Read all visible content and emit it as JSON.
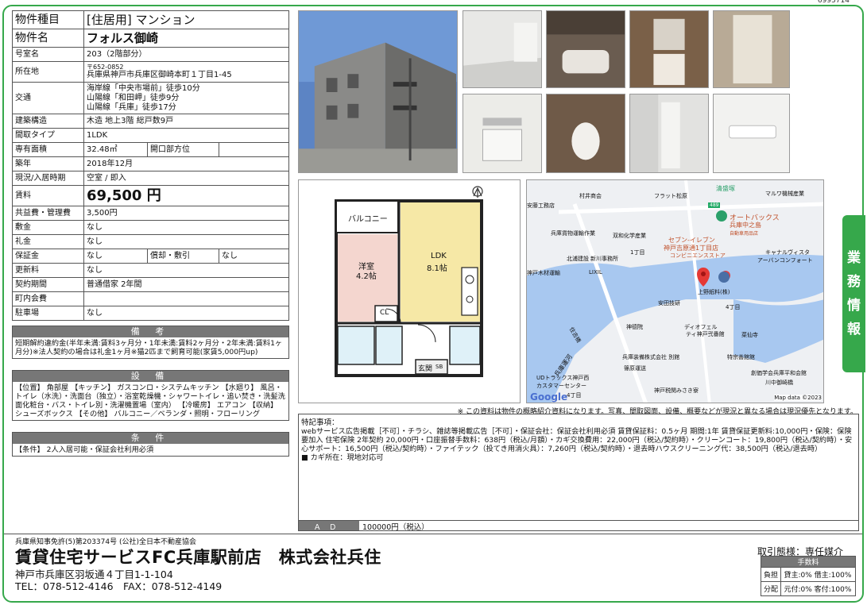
{
  "doc_id": "6995714",
  "spec": {
    "type_k": "物件種目",
    "type_v": "[住居用] マンション",
    "name_k": "物件名",
    "name_v": "フォルス御崎",
    "room_k": "号室名",
    "room_v": "203（2階部分）",
    "addr_k": "所在地",
    "zip": "〒652-0852",
    "addr_v": "兵庫県神戸市兵庫区御崎本町１丁目1-45",
    "access_k": "交通",
    "access_1": "海岸線「中央市場前」徒歩10分",
    "access_2": "山陽線「和田岬」徒歩9分",
    "access_3": "山陽線「兵庫」徒歩17分",
    "struct_k": "建築構造",
    "struct_v": "木造 地上3階 総戸数9戸",
    "layout_k": "間取タイプ",
    "layout_v": "1LDK",
    "area_k": "専有面積",
    "area_v": "32.48㎡",
    "dir_k": "開口部方位",
    "dir_v": "",
    "built_k": "築年",
    "built_v": "2018年12月",
    "status_k": "現況/入居時期",
    "status_v": "空室 / 即入",
    "rent_k": "賃料",
    "rent_v": "69,500 円",
    "mgmt_k": "共益費・管理費",
    "mgmt_v": "3,500円",
    "deposit_k": "敷金",
    "deposit_v": "なし",
    "key_k": "礼金",
    "key_v": "なし",
    "guar_k": "保証金",
    "guar_v": "なし",
    "amort_k": "償却・敷引",
    "amort_v": "なし",
    "renew_k": "更新料",
    "renew_v": "なし",
    "term_k": "契約期間",
    "term_v": "普通借家 2年間",
    "town_k": "町内会費",
    "town_v": "",
    "park_k": "駐車場",
    "park_v": "なし"
  },
  "notes": {
    "head": "備 考",
    "body": "短期解約違約金(半年未満:賃料3ヶ月分・1年未満:賃料2ヶ月分・2年未満:賃料1ヶ月分)※法人契約の場合は礼金1ヶ月※猫2匹まで飼育可能(家賃5,000円up)"
  },
  "equip": {
    "head": "設 備",
    "body": "【位置】 角部屋 【キッチン】 ガスコンロ・システムキッチン 【水廻り】 風呂・トイレ（水洗）・洗面台（独立）・浴室乾燥機・シャワートイレ・追い焚き・洗髪洗面化粧台・バス・トイレ別・洗濯機置場（室内） 【冷暖房】 エアコン 【収納】 シューズボックス 【その他】 バルコニー／ベランダ・照明・フローリング"
  },
  "cond": {
    "head": "条 件",
    "body": "【条件】 2人入居可能・保証会社利用必須"
  },
  "floorplan": {
    "balcony": "バルコニー",
    "western": "洋室",
    "western_size": "4.2帖",
    "ldk": "LDK",
    "ldk_size": "8.1帖",
    "cl": "CL",
    "entrance": "玄関",
    "sb": "SB"
  },
  "map": {
    "labels": [
      "清盛塚",
      "村井商会",
      "フラット松原",
      "マルワ機械産業",
      "安藤工務店",
      "兵庫貨物運輸作業",
      "双和化学産業",
      "オートバックス",
      "兵庫中之島",
      "自動車用品店",
      "セブン-イレブン",
      "神戸吉原通1丁目店",
      "コンビニエンスストア",
      "1丁目",
      "キャナルヴィスタ",
      "アーバンコンフォート",
      "北浦建設",
      "新川事務所",
      "LIXIL",
      "神戸木材運輸",
      "上野紙料(株)",
      "安田技研",
      "4丁目",
      "住吉橋",
      "兵庫運河",
      "神德院",
      "ディオフェル",
      "ティ神戸弐番館",
      "菜仙寺",
      "兵庫装備株式会社 別館",
      "篠原運送",
      "特宗善館館",
      "創価学会兵庫平和会館",
      "川中御崎橋",
      "UDトラックス神戸西",
      "カスタマーセンター",
      "神戸税関みさき寮",
      "4丁目",
      "489"
    ],
    "google": "Google",
    "credit": "Map data ©2023"
  },
  "disclaimer": "※ この資料は物件の概略紹介資料になります。写真、間取図面、設備、概要などが現況と異なる場合は現況優先となります。",
  "remarks": {
    "head": "特記事項：",
    "body": "webサービス広告掲載［不可］・チラシ、雑誌等掲載広告［不可］・保証会社：保証会社利用必須 賃貸保証料：0.5ヶ月 期間:1年 賃貸保証更新料:10,000円・保険：保険要加入 住宅保険 2年契約 20,000円・口座振替手数料：638円（税込/月額）・カギ交換費用：22,000円（税込/契約時）・クリーンコート：19,800円（税込/契約時）・安心サポート：16,500円（税込/契約時）・ファイテック（投てき用消火具）：7,260円（税込/契約時）・退去時ハウスクリーニング代：38,500円（税込/退去時）",
    "key": "■ カギ所在：現地対応可"
  },
  "ad": {
    "label": "ＡＤ",
    "value": "100000円（税込）"
  },
  "side_tab": [
    "業",
    "務",
    "情",
    "報"
  ],
  "footer": {
    "license": "兵庫県知事免許(5)第203374号 (公社)全日本不動産協会",
    "shop": "賃貸住宅サービスFC兵庫駅前店　株式会社兵住",
    "addr": "神戸市兵庫区羽坂通４丁目1-1-104",
    "tel": "TEL：078-512-4146　FAX：078-512-4149",
    "mode": "取引態様：専任媒介",
    "fee_head": "手数料",
    "fee_r1k": "負担",
    "fee_r1v": "貸主:0% 借主:100%",
    "fee_r2k": "分配",
    "fee_r2v": "元付:0% 客付:100%"
  },
  "colors": {
    "accent": "#36a84b",
    "header_gray": "#777777",
    "water": "#a8c8f0"
  }
}
